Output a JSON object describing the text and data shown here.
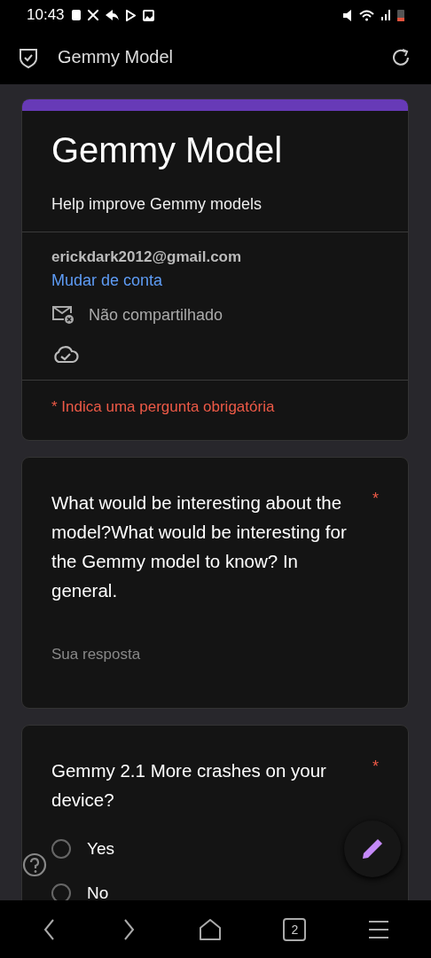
{
  "status_bar": {
    "time": "10:43"
  },
  "toolbar": {
    "title": "Gemmy Model"
  },
  "header": {
    "title": "Gemmy Model",
    "description": "Help improve Gemmy models",
    "email": "erickdark2012@gmail.com",
    "switch_account": "Mudar de conta",
    "sharing": "Não compartilhado",
    "required_note": "* Indica uma pergunta obrigatória"
  },
  "questions": [
    {
      "kind": "text",
      "title": "What would be interesting about the model?What would be interesting for the Gemmy model to know? In general.",
      "required": "*",
      "placeholder": "Sua resposta"
    },
    {
      "kind": "radio",
      "title": "Gemmy 2.1 More crashes on your device?",
      "required": "*",
      "options": [
        {
          "label": "Yes",
          "selected": false
        },
        {
          "label": "No",
          "selected": false
        }
      ]
    }
  ],
  "nav_bar": {
    "tabs_count": "2"
  }
}
